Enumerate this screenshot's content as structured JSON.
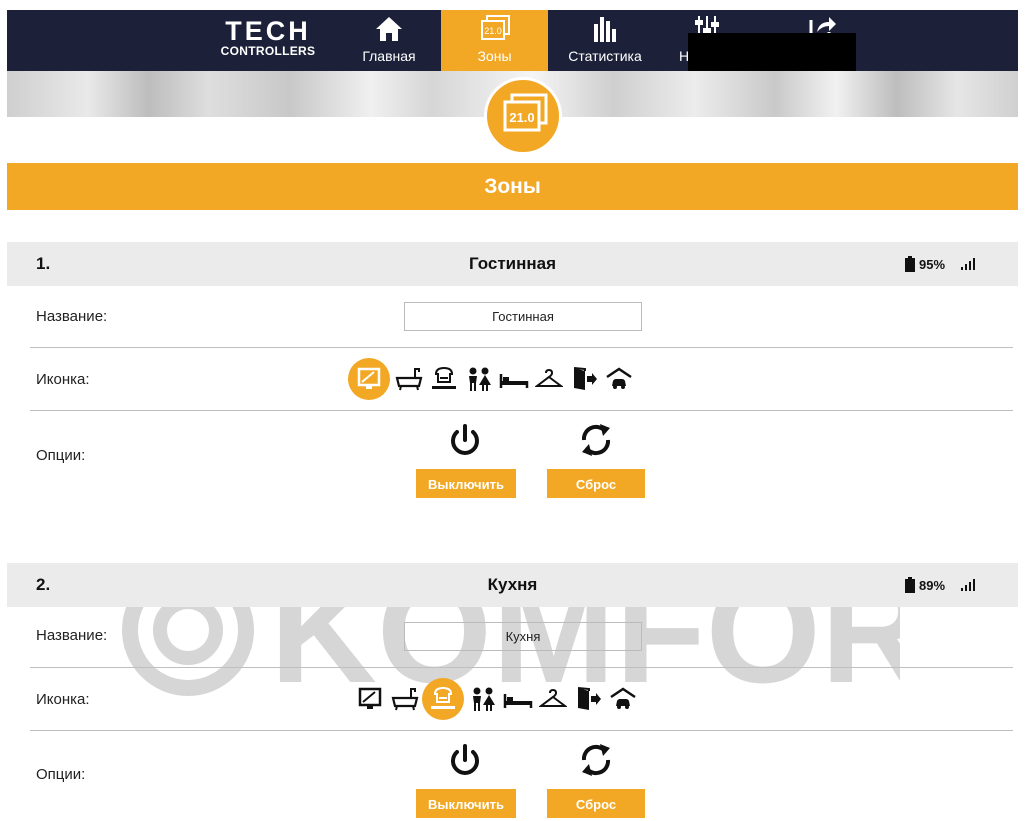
{
  "brand": {
    "line1": "TECH",
    "line2": "CONTROLLERS"
  },
  "nav": {
    "items": [
      {
        "label": "Главная",
        "icon": "home-icon"
      },
      {
        "label": "Зоны",
        "icon": "zones-icon",
        "active": true
      },
      {
        "label": "Статистика",
        "icon": "statistics-icon"
      },
      {
        "label": "На",
        "icon": "settings-sliders-icon"
      },
      {
        "label": "",
        "icon": "export-icon"
      }
    ]
  },
  "badge": {
    "value": "21.0"
  },
  "section": {
    "title": "Зоны"
  },
  "field_labels": {
    "name": "Название:",
    "icon": "Иконка:",
    "options": "Опции:"
  },
  "buttons": {
    "off": "Выключить",
    "reset": "Сброс"
  },
  "zone_icons": [
    "tv-icon",
    "bathtub-icon",
    "kitchen-icon",
    "kids-icon",
    "bed-icon",
    "hanger-icon",
    "door-icon",
    "garage-icon"
  ],
  "zones": [
    {
      "number": "1.",
      "name": "Гостинная",
      "battery": "95%",
      "name_value": "Гостинная",
      "selected_icon": "tv-icon"
    },
    {
      "number": "2.",
      "name": "Кухня",
      "battery": "89%",
      "name_value": "Кухня",
      "selected_icon": "kitchen-icon"
    }
  ],
  "watermark": {
    "text": "KOMFORT"
  },
  "colors": {
    "accent": "#f2a824",
    "nav_bg": "#1c2139",
    "head_bg": "#ebebeb"
  }
}
